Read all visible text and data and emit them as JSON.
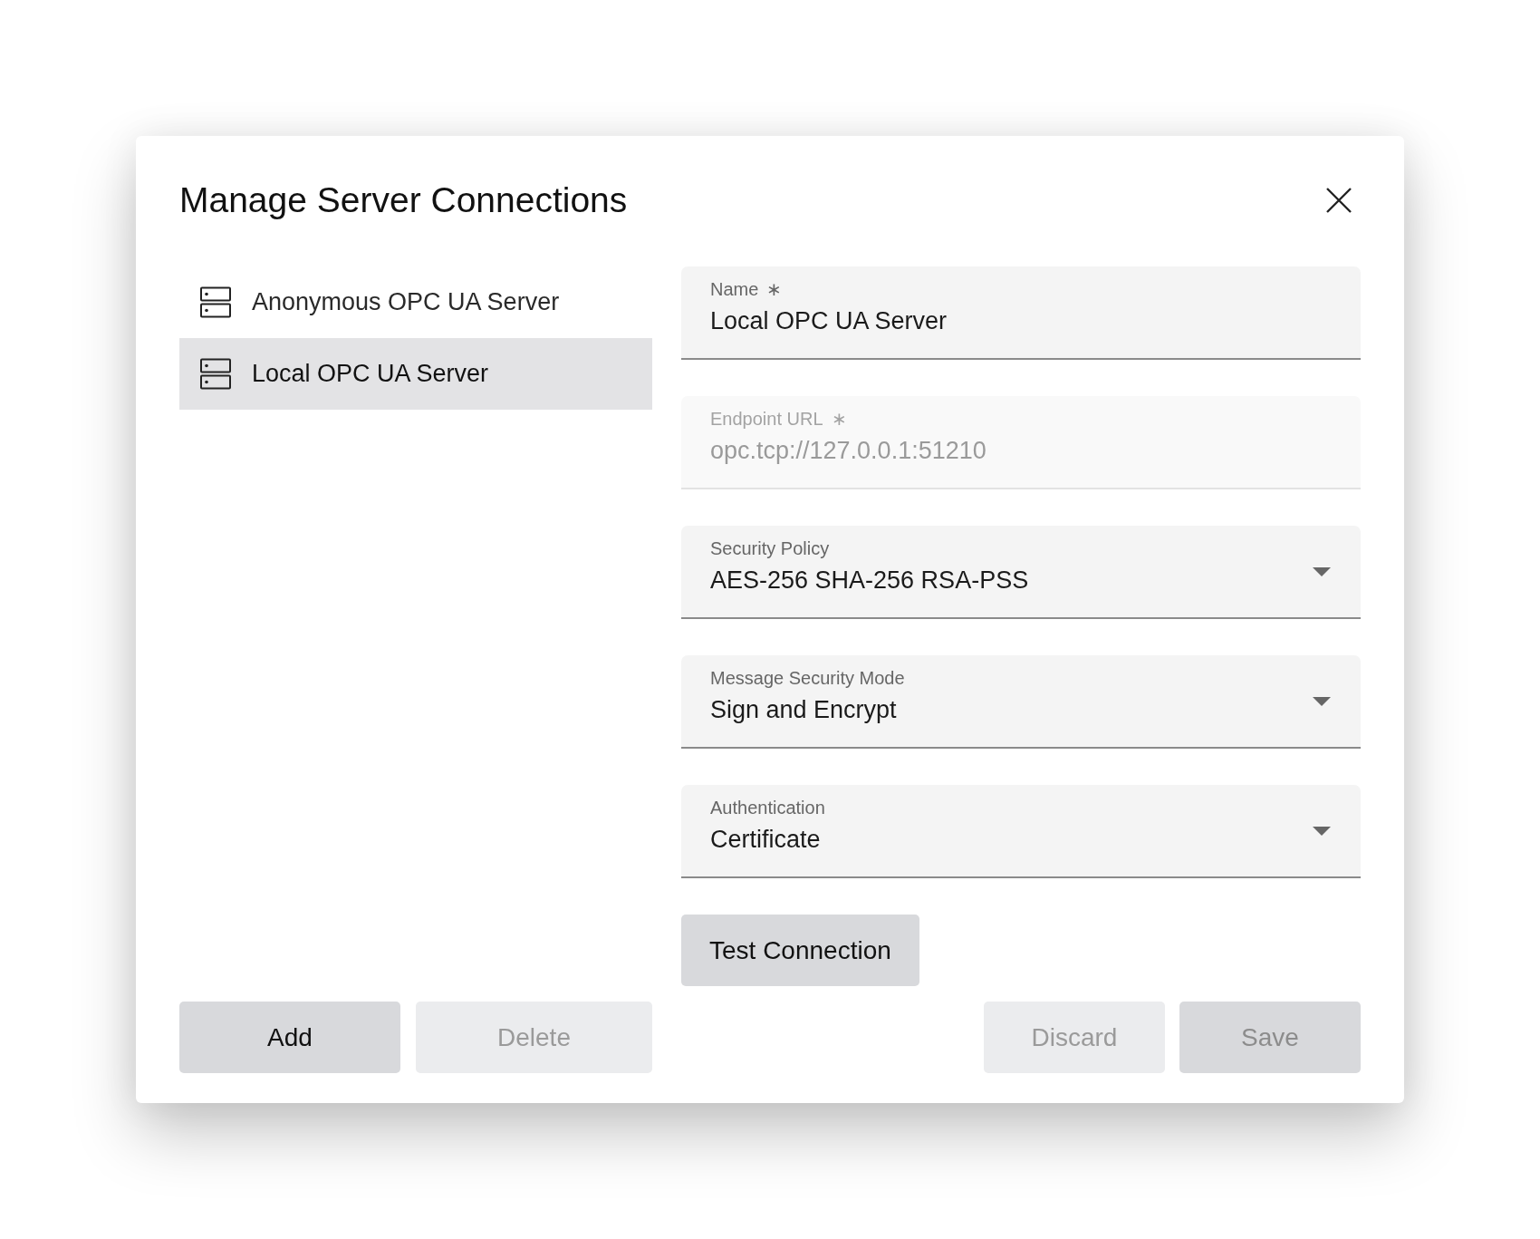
{
  "dialog": {
    "title": "Manage Server Connections"
  },
  "servers": [
    {
      "name": "Anonymous OPC UA Server",
      "selected": false
    },
    {
      "name": "Local OPC UA Server",
      "selected": true
    }
  ],
  "fields": [
    {
      "kind": "text",
      "label": "Name",
      "required_mark": "∗",
      "value": "Local OPC UA Server",
      "disabled": false
    },
    {
      "kind": "text",
      "label": "Endpoint URL",
      "required_mark": "∗",
      "value": "opc.tcp://127.0.0.1:51210",
      "disabled": true
    },
    {
      "kind": "select",
      "label": "Security Policy",
      "value": "AES-256 SHA-256 RSA-PSS",
      "disabled": false
    },
    {
      "kind": "select",
      "label": "Message Security Mode",
      "value": "Sign and Encrypt",
      "disabled": false
    },
    {
      "kind": "select",
      "label": "Authentication",
      "value": "Certificate",
      "disabled": false
    }
  ],
  "test_button": {
    "label": "Test Connection",
    "kind": "secondary",
    "disabled": false
  },
  "list_actions": [
    {
      "label": "Add",
      "kind": "secondary",
      "disabled": false
    },
    {
      "label": "Delete",
      "kind": "secondary",
      "disabled": true
    }
  ],
  "form_actions": [
    {
      "label": "Discard",
      "kind": "secondary",
      "disabled": true
    },
    {
      "label": "Save",
      "kind": "primary",
      "disabled": true
    }
  ]
}
